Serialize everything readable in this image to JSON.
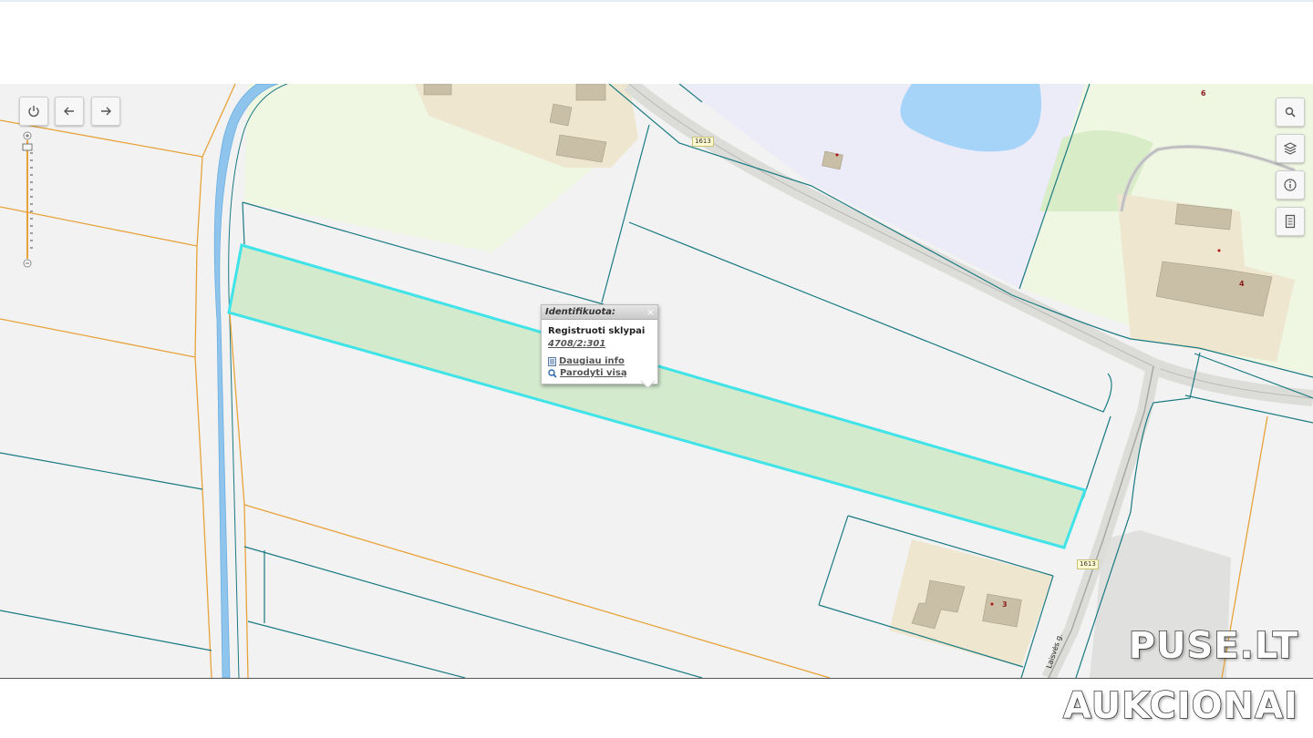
{
  "map": {
    "road_labels": [
      "1613",
      "1613"
    ],
    "street_name": "Laisvės g.",
    "house_numbers": [
      "6",
      "4",
      "3"
    ]
  },
  "popup": {
    "title": "Identifikuota:",
    "close_glyph": "×",
    "layer_name": "Registruoti sklypai",
    "parcel_id": "4708/2:301",
    "more_info_label": "Daugiau info",
    "show_all_label": "Parodyti visą"
  },
  "toolbar_left": {
    "buttons": [
      "power-icon",
      "arrow-left-icon",
      "arrow-right-icon"
    ]
  },
  "toolbar_right": {
    "buttons": [
      "search-icon",
      "layers-icon",
      "info-icon",
      "document-icon"
    ]
  },
  "watermark": {
    "line1": "PUSE.LT",
    "line2": "AUKCIONAI"
  },
  "colors": {
    "parcel_boundary": "#1a7a82",
    "cadastral_line": "#e8a23a",
    "selected_parcel_fill": "#cfe9c9",
    "selected_parcel_stroke": "#3fe3e8",
    "river": "#8fc4ec",
    "water_body": "#a6d3f8",
    "building_zone": "#efe6d0",
    "building": "#c9bfa6",
    "green_area": "#eff7e2",
    "purple_area": "#ececf8"
  }
}
